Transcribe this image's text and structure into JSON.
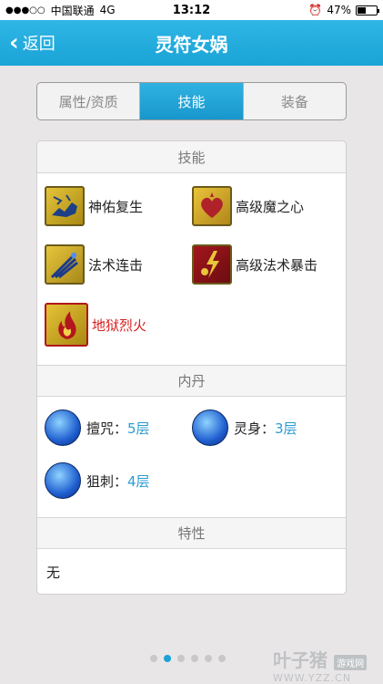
{
  "status": {
    "carrier": "中国联通",
    "network": "4G",
    "time": "13:12",
    "battery": "47%",
    "battery_level": 0.47
  },
  "nav": {
    "back_label": "返回",
    "title": "灵符女娲"
  },
  "tabs": [
    {
      "label": "属性/资质",
      "active": false
    },
    {
      "label": "技能",
      "active": true
    },
    {
      "label": "装备",
      "active": false
    }
  ],
  "skills_section": {
    "header": "技能",
    "items": [
      {
        "name": "神佑复生",
        "icon": "revive-icon",
        "highlight": false
      },
      {
        "name": "高级魔之心",
        "icon": "magic-heart-icon",
        "highlight": false
      },
      {
        "name": "法术连击",
        "icon": "spell-combo-icon",
        "highlight": false
      },
      {
        "name": "高级法术暴击",
        "icon": "spell-crit-icon",
        "highlight": false
      },
      {
        "name": "地狱烈火",
        "icon": "hellfire-icon",
        "highlight": true
      }
    ]
  },
  "neidan_section": {
    "header": "内丹",
    "items": [
      {
        "name": "擅咒：",
        "level": "5层"
      },
      {
        "name": "灵身：",
        "level": "3层"
      },
      {
        "name": "狙刺：",
        "level": "4层"
      }
    ]
  },
  "traits_section": {
    "header": "特性",
    "value": "无"
  },
  "pager": {
    "count": 6,
    "active_index": 1
  },
  "watermark": {
    "logo_text": "叶子猪",
    "badge": "游戏网",
    "url": "WWW.YZZ.CN"
  },
  "colors": {
    "accent": "#1aa3d6",
    "level_text": "#2a9bd1",
    "highlight_text": "#d81e1e"
  }
}
